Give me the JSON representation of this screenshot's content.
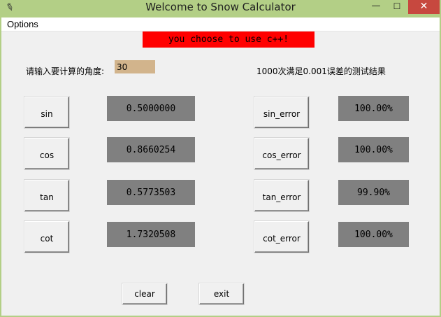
{
  "window": {
    "title": "Welcome to Snow Calculator",
    "minimize_glyph": "—",
    "maximize_glyph": "☐",
    "close_glyph": "✕",
    "app_icon": "feather-icon"
  },
  "menu": {
    "options_label": "Options"
  },
  "banner": {
    "text": "you choose to use c++!",
    "color": "#ff0000"
  },
  "input": {
    "label": "请输入要计算的角度:",
    "value": "30",
    "bg_color": "#d2b48c"
  },
  "results_header": "1000次满足0.001误差的测试结果",
  "rows": [
    {
      "fn_label": "sin",
      "value": "0.5000000",
      "error_label": "sin_error",
      "error_value": "100.00%"
    },
    {
      "fn_label": "cos",
      "value": "0.8660254",
      "error_label": "cos_error",
      "error_value": "100.00%"
    },
    {
      "fn_label": "tan",
      "value": "0.5773503",
      "error_label": "tan_error",
      "error_value": "99.90%"
    },
    {
      "fn_label": "cot",
      "value": "1.7320508",
      "error_label": "cot_error",
      "error_value": "100.00%"
    }
  ],
  "buttons": {
    "clear_label": "clear",
    "exit_label": "exit"
  },
  "colors": {
    "frame": "#b3cf86",
    "close_button": "#c7483f",
    "value_box": "#808080"
  }
}
